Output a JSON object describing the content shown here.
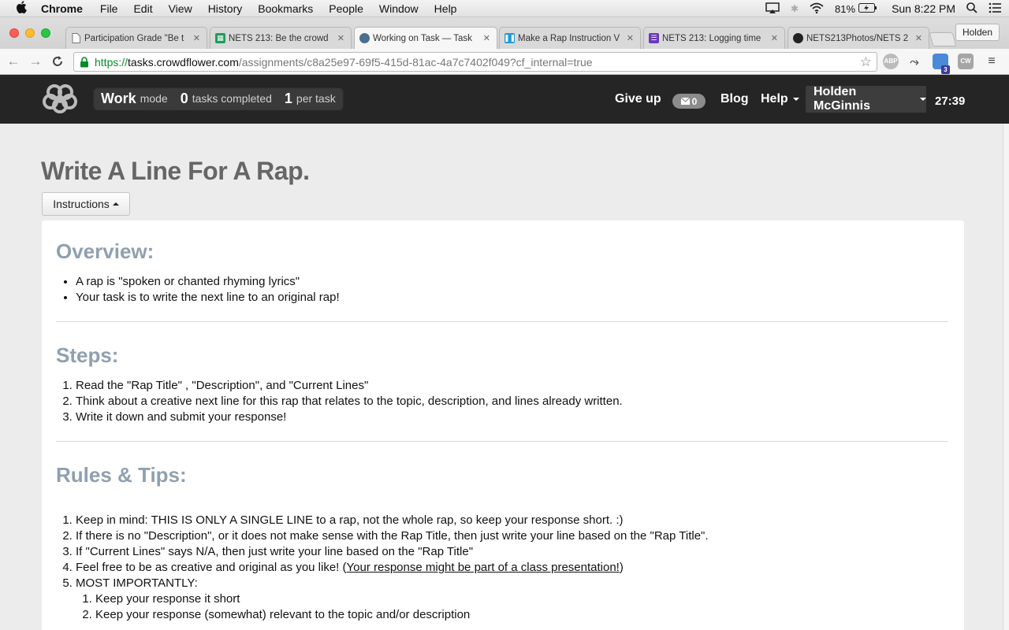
{
  "menubar": {
    "app_name": "Chrome",
    "items": [
      "File",
      "Edit",
      "View",
      "History",
      "Bookmarks",
      "People",
      "Window",
      "Help"
    ],
    "battery": "81%",
    "clock": "Sun 8:22 PM"
  },
  "tabs": [
    {
      "label": "Participation Grade \"Be t",
      "icon": "doc-icon",
      "active": false
    },
    {
      "label": "NETS 213: Be the crowd",
      "icon": "sheets-icon",
      "active": false
    },
    {
      "label": "Working on Task — Task",
      "icon": "crowdflower-icon",
      "active": true
    },
    {
      "label": "Make a Rap Instruction V",
      "icon": "pause-icon",
      "active": false
    },
    {
      "label": "NETS 213: Logging time",
      "icon": "forms-icon",
      "active": false
    },
    {
      "label": "NETS213Photos/NETS 2",
      "icon": "github-icon",
      "active": false
    }
  ],
  "profile": "Holden",
  "address": {
    "scheme": "https://",
    "host": "tasks.crowdflower.com",
    "path": "/assignments/c8a25e97-69f5-415d-81ac-4a7c7402f049?cf_internal=true"
  },
  "extensions": {
    "abp": "ABP",
    "mail_badge": "3",
    "cw": "CW"
  },
  "header": {
    "work": "Work",
    "mode": "mode",
    "completed_count": "0",
    "completed_label": "tasks completed",
    "per_task_count": "1",
    "per_task_label": "per task",
    "give_up": "Give up",
    "messages": "0",
    "blog": "Blog",
    "help": "Help",
    "user": "Holden McGinnis",
    "timer": "27:39"
  },
  "job": {
    "title": "Write A Line For A Rap.",
    "instructions_button": "Instructions"
  },
  "overview": {
    "heading": "Overview:",
    "items": [
      "A rap is \"spoken or chanted rhyming lyrics\"",
      "Your task is to write the next line to an original rap!"
    ]
  },
  "steps": {
    "heading": "Steps:",
    "items": [
      "Read the \"Rap Title\" , \"Description\", and \"Current Lines\"",
      "Think about a creative next line for this rap that relates to the topic, description, and lines already written.",
      "Write it down and submit your response!"
    ]
  },
  "rules": {
    "heading": "Rules & Tips:",
    "items": [
      "Keep in mind: THIS IS ONLY A SINGLE LINE to a rap, not the whole rap, so keep your response short. :)",
      "If there is no \"Description\", or it does not make sense with the Rap Title, then just write your line based on the \"Rap Title\".",
      "If \"Current Lines\" says N/A, then just write your line based on the \"Rap Title\""
    ],
    "item4_prefix": "Feel free to be as creative and original as you like! (",
    "item4_link": "Your response might be part of a class presentation!",
    "item4_suffix": ")",
    "item5": "MOST IMPORTANTLY:",
    "sub_items": [
      "Keep your response it short",
      "Keep your response (somewhat) relevant to the topic and/or description"
    ]
  }
}
